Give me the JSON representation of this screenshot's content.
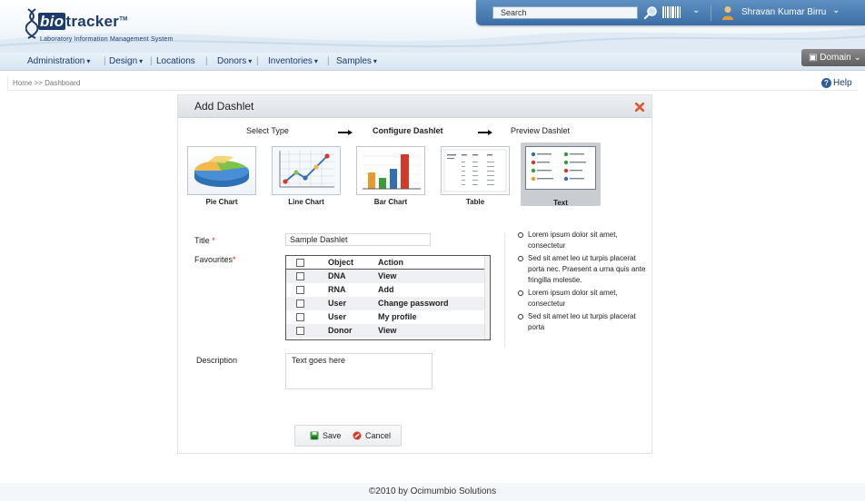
{
  "app": {
    "brand": "biotracker",
    "tagline": "Laboratory Information Management System"
  },
  "topbar": {
    "search_placeholder": "Search",
    "user_name": "Shravan Kumar Birru"
  },
  "nav": {
    "items": [
      {
        "label": "Administration",
        "has_menu": true
      },
      {
        "label": "Design",
        "has_menu": true
      },
      {
        "label": "Locations",
        "has_menu": false
      },
      {
        "label": "Donors",
        "has_menu": true
      },
      {
        "label": "Inventories",
        "has_menu": true
      },
      {
        "label": "Samples",
        "has_menu": true
      }
    ],
    "domain_label": "Domain"
  },
  "breadcrumb": "Home >> Dashboard",
  "help_label": "Help",
  "dialog": {
    "title": "Add Dashlet",
    "steps": [
      "Select Type",
      "Configure Dashlet",
      "Preview Dashlet"
    ],
    "active_step": 1,
    "types": [
      {
        "label": "Pie Chart",
        "icon": "pie-chart-icon"
      },
      {
        "label": "Line Chart",
        "icon": "line-chart-icon"
      },
      {
        "label": "Bar Chart",
        "icon": "bar-chart-icon"
      },
      {
        "label": "Table",
        "icon": "table-icon"
      },
      {
        "label": "Text",
        "icon": "text-icon",
        "selected": true
      }
    ],
    "form": {
      "title_label": "Title",
      "title_value": "Sample Dashlet",
      "favourites_label": "Favourites",
      "favourites_columns": [
        "Object",
        "Action"
      ],
      "favourites_rows": [
        {
          "object": "DNA",
          "action": "View"
        },
        {
          "object": "RNA",
          "action": "Add"
        },
        {
          "object": "User",
          "action": "Change password"
        },
        {
          "object": "User",
          "action": "My profile"
        },
        {
          "object": "Donor",
          "action": "View"
        }
      ],
      "description_label": "Description",
      "description_value": "Text goes here"
    },
    "preview_bullets": [
      "Lorem ipsum dolor sit amet, consectetur",
      "Sed sit amet leo ut turpis placerat porta nec. Praesent a urna quis ante fringilla molestie.",
      "Lorem ipsum dolor sit amet, consectetur",
      "Sed sit amet leo ut turpis placerat porta"
    ],
    "buttons": {
      "save": "Save",
      "cancel": "Cancel"
    }
  },
  "footer": "©2010 by Ocimumbio Solutions",
  "colors": {
    "brand_navy": "#1c3a6c",
    "topbar_blue": "#3c6ea6",
    "close_orange": "#e2542a",
    "required_red": "#dd2222"
  }
}
